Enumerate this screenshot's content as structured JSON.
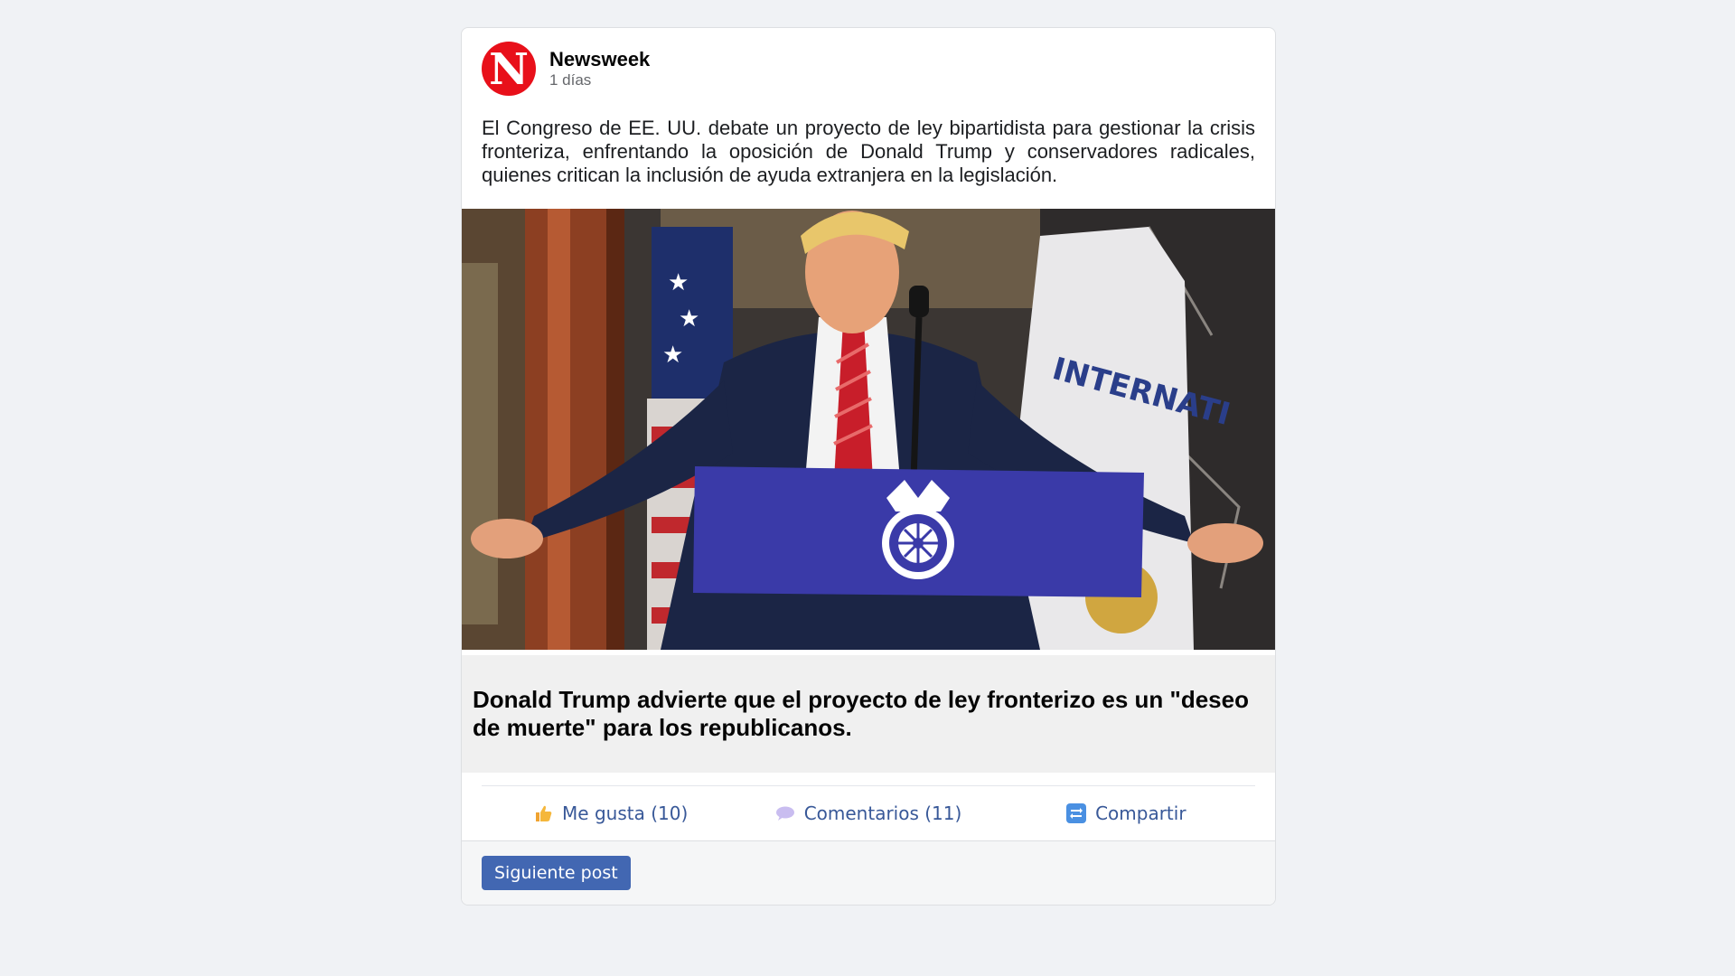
{
  "post": {
    "author": "Newsweek",
    "avatar_letter": "N",
    "time": "1 días",
    "text": "El Congreso de EE. UU. debate un proyecto de ley bipartidista para gestionar la crisis fronteriza, enfrentando la oposición de Donald Trump y conservadores radicales, quienes critican la inclusión de ayuda extranjera en la legislación.",
    "link_title": "Donald Trump advierte que el proyecto de ley fronterizo es un \"deseo de muerte\" para los republicanos."
  },
  "actions": {
    "like_label": "Me gusta (10)",
    "comments_label": "Comentarios (11)",
    "share_label": "Compartir"
  },
  "footer": {
    "next_label": "Siguiente post"
  },
  "colors": {
    "brand_red": "#e8101a",
    "link_blue": "#385898",
    "button_blue": "#4267b2",
    "podium_blue": "#3a3aa8"
  },
  "icons": {
    "like": "thumbs-up-icon",
    "comment": "speech-bubble-icon",
    "share": "share-arrows-icon"
  }
}
